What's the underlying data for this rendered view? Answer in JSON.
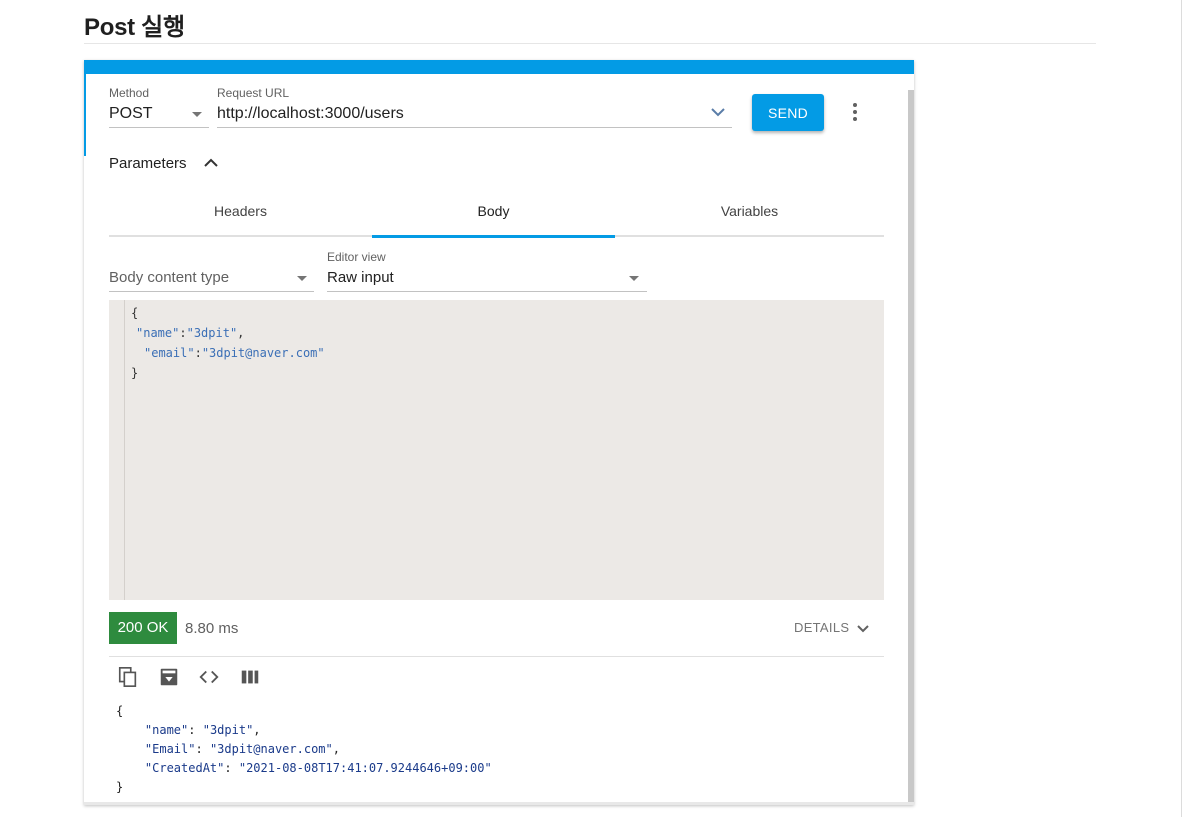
{
  "page": {
    "title": "Post 실행"
  },
  "request": {
    "method_label": "Method",
    "method_value": "POST",
    "url_label": "Request URL",
    "url_value": "http://localhost:3000/users",
    "send_label": "SEND",
    "parameters_label": "Parameters"
  },
  "tabs": [
    {
      "label": "Headers",
      "active": false
    },
    {
      "label": "Body",
      "active": true
    },
    {
      "label": "Variables",
      "active": false
    }
  ],
  "body": {
    "content_type_placeholder": "Body content type",
    "editor_view_label": "Editor view",
    "editor_view_value": "Raw input",
    "lines": {
      "open": "{",
      "name_key": "\"name\"",
      "name_colon": ":",
      "name_value": "\"3dpit\"",
      "name_comma": ",",
      "email_key": "\"email\"",
      "email_colon": ":",
      "email_value": "\"3dpit@naver.com\"",
      "close": "}"
    }
  },
  "response": {
    "status": "200 OK",
    "timing": "8.80 ms",
    "details_label": "DETAILS",
    "json": {
      "open": "{",
      "name_key": "\"name\"",
      "name_value": "\"3dpit\"",
      "email_key": "\"Email\"",
      "email_value": "\"3dpit@naver.com\"",
      "created_key": "\"CreatedAt\"",
      "created_value": "\"2021-08-08T17:41:07.9244646+09:00\"",
      "close": "}"
    }
  },
  "icons": {
    "copy": "copy-icon",
    "save": "save-icon",
    "code": "code-icon",
    "columns": "columns-icon",
    "more": "more-vert-icon"
  },
  "colors": {
    "accent": "#039be5",
    "status_ok": "#2e8b3e",
    "editor_bg": "#ece9e6"
  }
}
